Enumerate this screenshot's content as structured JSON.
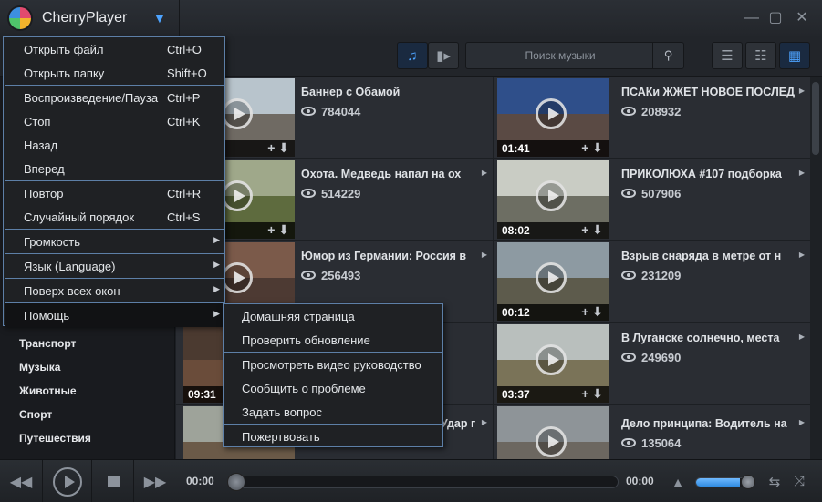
{
  "app": {
    "title": "CherryPlayer"
  },
  "search": {
    "placeholder": "Поиск музыки"
  },
  "sidebar": {
    "categories": [
      "Транспорт",
      "Музыка",
      "Животные",
      "Спорт",
      "Путешествия"
    ]
  },
  "videos": [
    {
      "title": "Баннер с Обамой",
      "views": "784044",
      "duration": ""
    },
    {
      "title": "ПСАКи ЖЖЕТ НОВОЕ ПОСЛЕД",
      "views": "208932",
      "duration": "01:41"
    },
    {
      "title": "Охота. Медведь напал на ох",
      "views": "514229",
      "duration": ""
    },
    {
      "title": "ПРИКОЛЮХА #107 подборка",
      "views": "507906",
      "duration": "08:02"
    },
    {
      "title": "Юмор из Германии: Россия в",
      "views": "256493",
      "duration": ""
    },
    {
      "title": "Взрыв снаряда  в метре от н",
      "views": "231209",
      "duration": "00:12"
    },
    {
      "title": "",
      "views": "",
      "duration": "09:31"
    },
    {
      "title": "В Луганске солнечно, места",
      "views": "249690",
      "duration": "03:37"
    },
    {
      "title": "Удар г",
      "views": "",
      "duration": ""
    },
    {
      "title": "Дело принципа: Водитель на",
      "views": "135064",
      "duration": ""
    }
  ],
  "player": {
    "time_current": "00:00",
    "time_total": "00:00",
    "volume": 0.8,
    "progress": 0
  },
  "menu": {
    "items": [
      {
        "label": "Открыть файл",
        "shortcut": "Ctrl+O"
      },
      {
        "label": "Открыть папку",
        "shortcut": "Shift+O"
      },
      {
        "label": "Воспроизведение/Пауза",
        "shortcut": "Ctrl+P"
      },
      {
        "label": "Стоп",
        "shortcut": "Ctrl+K"
      },
      {
        "label": "Назад",
        "shortcut": ""
      },
      {
        "label": "Вперед",
        "shortcut": ""
      },
      {
        "label": "Повтор",
        "shortcut": "Ctrl+R"
      },
      {
        "label": "Случайный порядок",
        "shortcut": "Ctrl+S"
      },
      {
        "label": "Громкость",
        "shortcut": ""
      },
      {
        "label": "Язык (Language)",
        "shortcut": ""
      },
      {
        "label": "Поверх всех окон",
        "shortcut": ""
      },
      {
        "label": "Помощь",
        "shortcut": ""
      }
    ]
  },
  "submenu": {
    "items": [
      {
        "label": "Домашняя страница"
      },
      {
        "label": "Проверить обновление"
      },
      {
        "label": "Просмотреть видео руководство"
      },
      {
        "label": "Сообщить о проблеме"
      },
      {
        "label": "Задать вопрос"
      },
      {
        "label": "Пожертвовать"
      }
    ]
  },
  "colors": {
    "accent": "#4da3ff",
    "menu_border": "#5d7fa7",
    "background": "#2a2d33"
  }
}
